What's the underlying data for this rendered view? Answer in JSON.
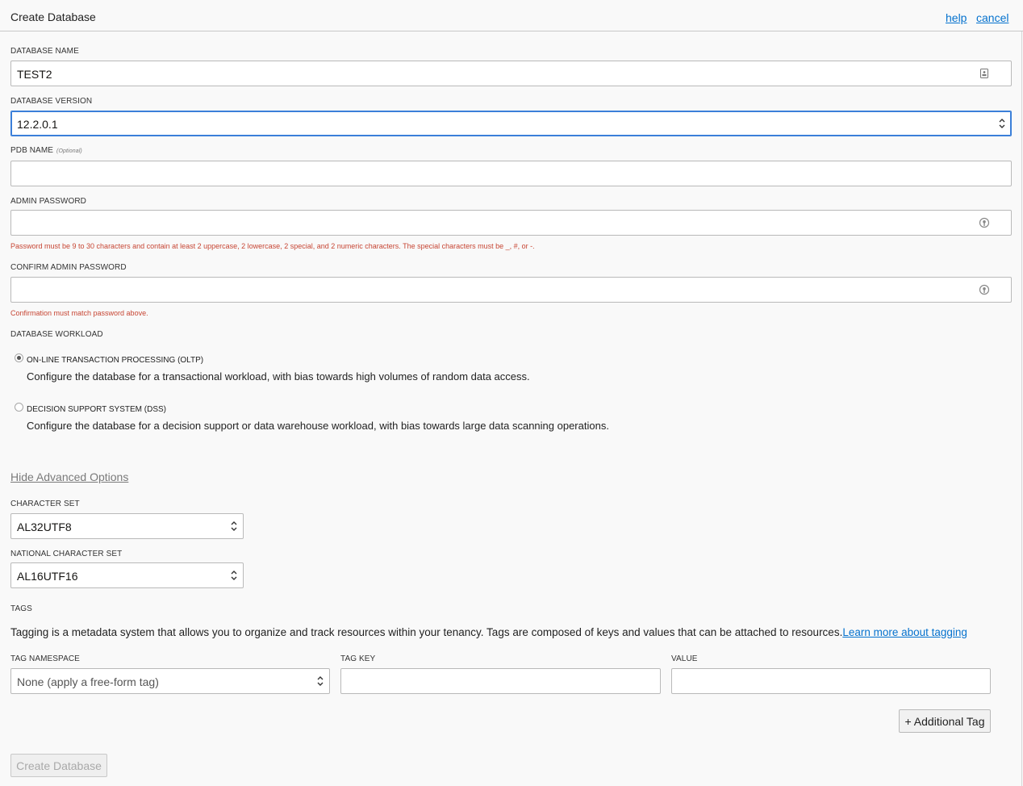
{
  "header": {
    "title": "Create Database",
    "help": "help",
    "cancel": "cancel"
  },
  "fields": {
    "db_name": {
      "label": "DATABASE NAME",
      "value": "TEST2"
    },
    "db_version": {
      "label": "DATABASE VERSION",
      "value": "12.2.0.1"
    },
    "pdb_name": {
      "label": "PDB NAME",
      "optional": "(Optional)",
      "value": ""
    },
    "admin_password": {
      "label": "ADMIN PASSWORD",
      "value": "",
      "error": "Password must be 9 to 30 characters and contain at least 2 uppercase, 2 lowercase, 2 special, and 2 numeric characters. The special characters must be _, #, or -."
    },
    "confirm_password": {
      "label": "CONFIRM ADMIN PASSWORD",
      "value": "",
      "error": "Confirmation must match password above."
    }
  },
  "workload": {
    "label": "DATABASE WORKLOAD",
    "options": [
      {
        "title": "ON-LINE TRANSACTION PROCESSING (OLTP)",
        "desc": "Configure the database for a transactional workload, with bias towards high volumes of random data access.",
        "checked": true
      },
      {
        "title": "DECISION SUPPORT SYSTEM (DSS)",
        "desc": "Configure the database for a decision support or data warehouse workload, with bias towards large data scanning operations.",
        "checked": false
      }
    ]
  },
  "advanced": {
    "toggle": "Hide Advanced Options",
    "charset": {
      "label": "CHARACTER SET",
      "value": "AL32UTF8"
    },
    "ncharset": {
      "label": "NATIONAL CHARACTER SET",
      "value": "AL16UTF16"
    }
  },
  "tags": {
    "label": "TAGS",
    "description": "Tagging is a metadata system that allows you to organize and track resources within your tenancy. Tags are composed of keys and values that can be attached to resources.",
    "learn_more": "Learn more about tagging",
    "namespace": {
      "label": "TAG NAMESPACE",
      "value": "None (apply a free-form tag)"
    },
    "key": {
      "label": "TAG KEY",
      "value": ""
    },
    "value": {
      "label": "VALUE",
      "value": ""
    },
    "add_button": "+ Additional Tag"
  },
  "submit": {
    "label": "Create Database",
    "disabled": true
  },
  "colors": {
    "link": "#0572ce",
    "error": "#c74634",
    "focus": "#3b7fd9"
  }
}
